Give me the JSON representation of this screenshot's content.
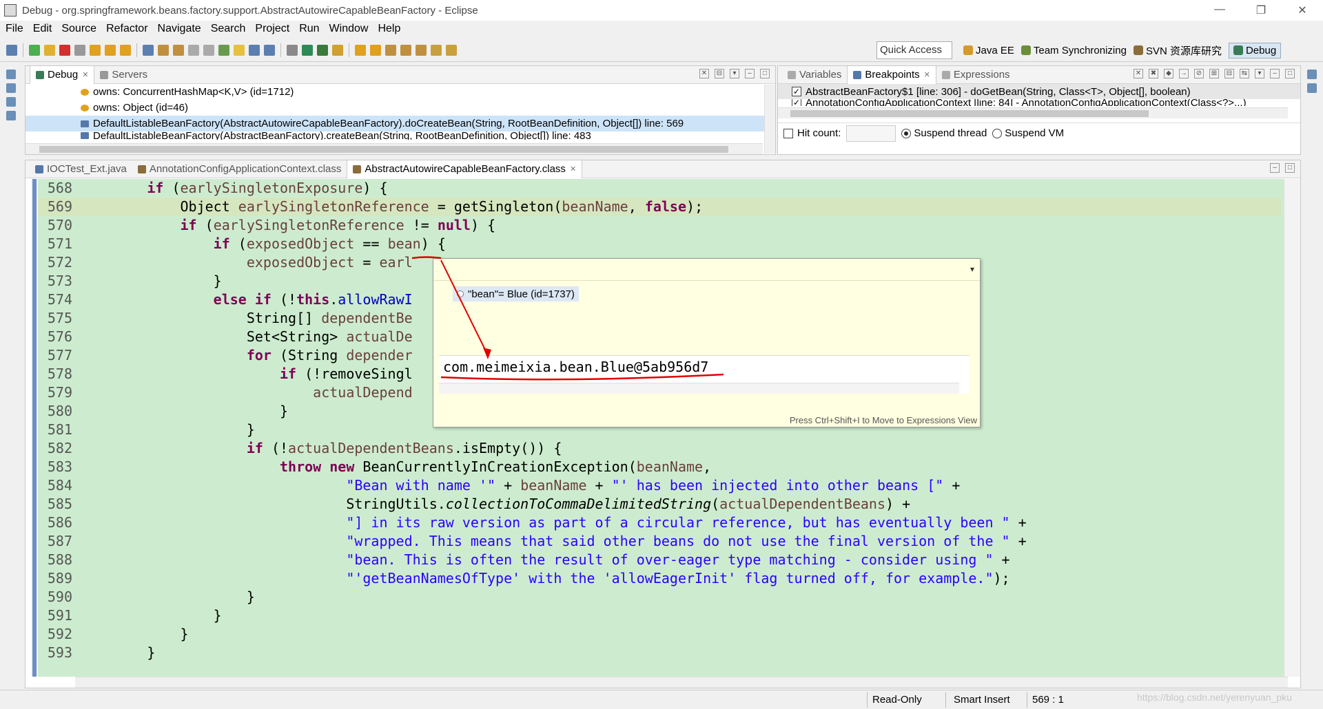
{
  "window": {
    "title": "Debug - org.springframework.beans.factory.support.AbstractAutowireCapableBeanFactory - Eclipse",
    "controls": [
      "—",
      "❐",
      "✕"
    ]
  },
  "menu": [
    "File",
    "Edit",
    "Source",
    "Refactor",
    "Navigate",
    "Search",
    "Project",
    "Run",
    "Window",
    "Help"
  ],
  "toolbar": {
    "quick_access": "Quick Access",
    "perspectives": [
      {
        "label": "Java EE",
        "color": "#d59a2a"
      },
      {
        "label": "Team Synchronizing",
        "color": "#6b8e3a"
      },
      {
        "label": "SVN 资源库研究",
        "color": "#8a6d3b"
      },
      {
        "label": "Debug",
        "color": "#3b7a57",
        "active": true
      }
    ]
  },
  "debug_view": {
    "tabs": [
      "Debug",
      "Servers"
    ],
    "rows": [
      {
        "text": "owns: ConcurrentHashMap<K,V>  (id=1712)",
        "icon_color": "#e0a020"
      },
      {
        "text": "owns: Object  (id=46)",
        "icon_color": "#e0a020"
      },
      {
        "text": "DefaultListableBeanFactory(AbstractAutowireCapableBeanFactory).doCreateBean(String, RootBeanDefinition, Object[]) line: 569",
        "icon_color": "#5577aa",
        "selected": true
      },
      {
        "text": "DefaultListableBeanFactory(AbstractBeanFactory).createBean(String, RootBeanDefinition, Object[]) line: 483",
        "icon_color": "#5577aa"
      }
    ]
  },
  "breakpoints_view": {
    "tabs": [
      "Variables",
      "Breakpoints",
      "Expressions"
    ],
    "rows": [
      {
        "text": "AbstractBeanFactory$1 [line: 306] - doGetBean(String, Class<T>, Object[], boolean)",
        "checked": true
      },
      {
        "text": "AnnotationConfigApplicationContext [line: 84] - AnnotationConfigApplicationContext(Class<?>...)",
        "checked": true
      }
    ],
    "hit_count_label": "Hit count:",
    "suspend_thread": "Suspend thread",
    "suspend_vm": "Suspend VM"
  },
  "editor": {
    "tabs": [
      {
        "label": "IOCTest_Ext.java",
        "active": false
      },
      {
        "label": "AnnotationConfigApplicationContext.class",
        "active": false
      },
      {
        "label": "AbstractAutowireCapableBeanFactory.class",
        "active": true
      }
    ],
    "current_line": 569
  },
  "hover": {
    "node_label": "\"bean\"= Blue  (id=1737)",
    "value": "com.meimeixia.bean.Blue@5ab956d7",
    "hint": "Press Ctrl+Shift+I to Move to Expressions View",
    "dropdown": "▾"
  },
  "status": {
    "mode": "Read-Only",
    "insert": "Smart Insert",
    "position": "569 : 1"
  },
  "watermark": "https://blog.csdn.net/yerenyuan_pku",
  "colors": {
    "editor_bg": "#cdeccf",
    "keyword": "#7f0055",
    "field": "#0000c0",
    "string": "#2a00ff",
    "annotation": "#e00000"
  }
}
